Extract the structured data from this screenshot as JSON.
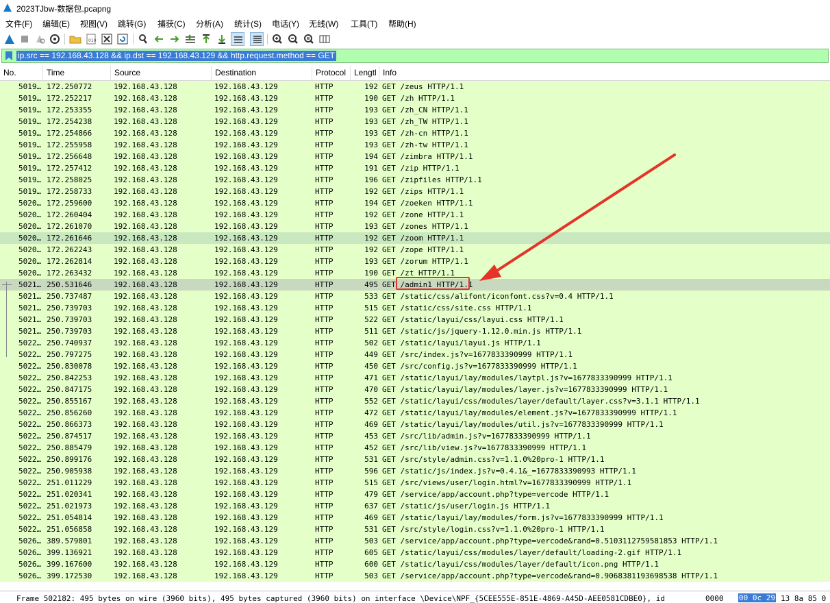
{
  "window": {
    "title": "2023TJbw-数据包.pcapng"
  },
  "menu": [
    "文件(F)",
    "编辑(E)",
    "视图(V)",
    "跳转(G)",
    "捕获(C)",
    "分析(A)",
    "统计(S)",
    "电话(Y)",
    "无线(W)",
    "工具(T)",
    "帮助(H)"
  ],
  "toolbar": {
    "icons": [
      "shark-fin-icon",
      "stop-icon",
      "restart-icon",
      "options-gear-icon",
      "open-folder-icon",
      "save-file-icon",
      "close-file-icon",
      "reload-icon",
      "find-icon",
      "back-arrow-icon",
      "forward-arrow-icon",
      "goto-packet-icon",
      "first-packet-icon",
      "last-packet-icon",
      "autoscroll-icon",
      "colorize-icon",
      "zoom-in-icon",
      "zoom-out-icon",
      "zoom-reset-icon",
      "resize-columns-icon"
    ]
  },
  "filter": {
    "value": "ip.src == 192.168.43.128 && ip.dst == 192.168.43.129 && http.request.method == GET"
  },
  "columns": [
    "No.",
    "Time",
    "Source",
    "Destination",
    "Protocol",
    "Lengtl",
    "Info"
  ],
  "packets": [
    {
      "no": "5019…",
      "time": "172.250772",
      "src": "192.168.43.128",
      "dst": "192.168.43.129",
      "proto": "HTTP",
      "len": "192",
      "info": "GET /zeus HTTP/1.1"
    },
    {
      "no": "5019…",
      "time": "172.252217",
      "src": "192.168.43.128",
      "dst": "192.168.43.129",
      "proto": "HTTP",
      "len": "190",
      "info": "GET /zh HTTP/1.1"
    },
    {
      "no": "5019…",
      "time": "172.253355",
      "src": "192.168.43.128",
      "dst": "192.168.43.129",
      "proto": "HTTP",
      "len": "193",
      "info": "GET /zh_CN HTTP/1.1"
    },
    {
      "no": "5019…",
      "time": "172.254238",
      "src": "192.168.43.128",
      "dst": "192.168.43.129",
      "proto": "HTTP",
      "len": "193",
      "info": "GET /zh_TW HTTP/1.1"
    },
    {
      "no": "5019…",
      "time": "172.254866",
      "src": "192.168.43.128",
      "dst": "192.168.43.129",
      "proto": "HTTP",
      "len": "193",
      "info": "GET /zh-cn HTTP/1.1"
    },
    {
      "no": "5019…",
      "time": "172.255958",
      "src": "192.168.43.128",
      "dst": "192.168.43.129",
      "proto": "HTTP",
      "len": "193",
      "info": "GET /zh-tw HTTP/1.1"
    },
    {
      "no": "5019…",
      "time": "172.256648",
      "src": "192.168.43.128",
      "dst": "192.168.43.129",
      "proto": "HTTP",
      "len": "194",
      "info": "GET /zimbra HTTP/1.1"
    },
    {
      "no": "5019…",
      "time": "172.257412",
      "src": "192.168.43.128",
      "dst": "192.168.43.129",
      "proto": "HTTP",
      "len": "191",
      "info": "GET /zip HTTP/1.1"
    },
    {
      "no": "5019…",
      "time": "172.258025",
      "src": "192.168.43.128",
      "dst": "192.168.43.129",
      "proto": "HTTP",
      "len": "196",
      "info": "GET /zipfiles HTTP/1.1"
    },
    {
      "no": "5019…",
      "time": "172.258733",
      "src": "192.168.43.128",
      "dst": "192.168.43.129",
      "proto": "HTTP",
      "len": "192",
      "info": "GET /zips HTTP/1.1"
    },
    {
      "no": "5020…",
      "time": "172.259600",
      "src": "192.168.43.128",
      "dst": "192.168.43.129",
      "proto": "HTTP",
      "len": "194",
      "info": "GET /zoeken HTTP/1.1"
    },
    {
      "no": "5020…",
      "time": "172.260404",
      "src": "192.168.43.128",
      "dst": "192.168.43.129",
      "proto": "HTTP",
      "len": "192",
      "info": "GET /zone HTTP/1.1"
    },
    {
      "no": "5020…",
      "time": "172.261070",
      "src": "192.168.43.128",
      "dst": "192.168.43.129",
      "proto": "HTTP",
      "len": "193",
      "info": "GET /zones HTTP/1.1"
    },
    {
      "no": "5020…",
      "time": "172.261646",
      "src": "192.168.43.128",
      "dst": "192.168.43.129",
      "proto": "HTTP",
      "len": "192",
      "info": "GET /zoom HTTP/1.1",
      "alt": true
    },
    {
      "no": "5020…",
      "time": "172.262243",
      "src": "192.168.43.128",
      "dst": "192.168.43.129",
      "proto": "HTTP",
      "len": "192",
      "info": "GET /zope HTTP/1.1"
    },
    {
      "no": "5020…",
      "time": "172.262814",
      "src": "192.168.43.128",
      "dst": "192.168.43.129",
      "proto": "HTTP",
      "len": "193",
      "info": "GET /zorum HTTP/1.1"
    },
    {
      "no": "5020…",
      "time": "172.263432",
      "src": "192.168.43.128",
      "dst": "192.168.43.129",
      "proto": "HTTP",
      "len": "190",
      "info": "GET /zt HTTP/1.1"
    },
    {
      "no": "5021…",
      "time": "250.531646",
      "src": "192.168.43.128",
      "dst": "192.168.43.129",
      "proto": "HTTP",
      "len": "495",
      "info": "GET /admin1 HTTP/1.1",
      "selected": true
    },
    {
      "no": "5021…",
      "time": "250.737487",
      "src": "192.168.43.128",
      "dst": "192.168.43.129",
      "proto": "HTTP",
      "len": "533",
      "info": "GET /static/css/alifont/iconfont.css?v=0.4 HTTP/1.1"
    },
    {
      "no": "5021…",
      "time": "250.739703",
      "src": "192.168.43.128",
      "dst": "192.168.43.129",
      "proto": "HTTP",
      "len": "515",
      "info": "GET /static/css/site.css HTTP/1.1"
    },
    {
      "no": "5021…",
      "time": "250.739703",
      "src": "192.168.43.128",
      "dst": "192.168.43.129",
      "proto": "HTTP",
      "len": "522",
      "info": "GET /static/layui/css/layui.css HTTP/1.1"
    },
    {
      "no": "5021…",
      "time": "250.739703",
      "src": "192.168.43.128",
      "dst": "192.168.43.129",
      "proto": "HTTP",
      "len": "511",
      "info": "GET /static/js/jquery-1.12.0.min.js HTTP/1.1"
    },
    {
      "no": "5022…",
      "time": "250.740937",
      "src": "192.168.43.128",
      "dst": "192.168.43.129",
      "proto": "HTTP",
      "len": "502",
      "info": "GET /static/layui/layui.js HTTP/1.1"
    },
    {
      "no": "5022…",
      "time": "250.797275",
      "src": "192.168.43.128",
      "dst": "192.168.43.129",
      "proto": "HTTP",
      "len": "449",
      "info": "GET /src/index.js?v=1677833390999 HTTP/1.1"
    },
    {
      "no": "5022…",
      "time": "250.830078",
      "src": "192.168.43.128",
      "dst": "192.168.43.129",
      "proto": "HTTP",
      "len": "450",
      "info": "GET /src/config.js?v=1677833390999 HTTP/1.1"
    },
    {
      "no": "5022…",
      "time": "250.842253",
      "src": "192.168.43.128",
      "dst": "192.168.43.129",
      "proto": "HTTP",
      "len": "471",
      "info": "GET /static/layui/lay/modules/laytpl.js?v=1677833390999 HTTP/1.1"
    },
    {
      "no": "5022…",
      "time": "250.847175",
      "src": "192.168.43.128",
      "dst": "192.168.43.129",
      "proto": "HTTP",
      "len": "470",
      "info": "GET /static/layui/lay/modules/layer.js?v=1677833390999 HTTP/1.1"
    },
    {
      "no": "5022…",
      "time": "250.855167",
      "src": "192.168.43.128",
      "dst": "192.168.43.129",
      "proto": "HTTP",
      "len": "552",
      "info": "GET /static/layui/css/modules/layer/default/layer.css?v=3.1.1 HTTP/1.1"
    },
    {
      "no": "5022…",
      "time": "250.856260",
      "src": "192.168.43.128",
      "dst": "192.168.43.129",
      "proto": "HTTP",
      "len": "472",
      "info": "GET /static/layui/lay/modules/element.js?v=1677833390999 HTTP/1.1"
    },
    {
      "no": "5022…",
      "time": "250.866373",
      "src": "192.168.43.128",
      "dst": "192.168.43.129",
      "proto": "HTTP",
      "len": "469",
      "info": "GET /static/layui/lay/modules/util.js?v=1677833390999 HTTP/1.1"
    },
    {
      "no": "5022…",
      "time": "250.874517",
      "src": "192.168.43.128",
      "dst": "192.168.43.129",
      "proto": "HTTP",
      "len": "453",
      "info": "GET /src/lib/admin.js?v=1677833390999 HTTP/1.1"
    },
    {
      "no": "5022…",
      "time": "250.885479",
      "src": "192.168.43.128",
      "dst": "192.168.43.129",
      "proto": "HTTP",
      "len": "452",
      "info": "GET /src/lib/view.js?v=1677833390999 HTTP/1.1"
    },
    {
      "no": "5022…",
      "time": "250.899176",
      "src": "192.168.43.128",
      "dst": "192.168.43.129",
      "proto": "HTTP",
      "len": "531",
      "info": "GET /src/style/admin.css?v=1.1.0%20pro-1 HTTP/1.1"
    },
    {
      "no": "5022…",
      "time": "250.905938",
      "src": "192.168.43.128",
      "dst": "192.168.43.129",
      "proto": "HTTP",
      "len": "596",
      "info": "GET /static/js/index.js?v=0.4.1&_=1677833390993 HTTP/1.1"
    },
    {
      "no": "5022…",
      "time": "251.011229",
      "src": "192.168.43.128",
      "dst": "192.168.43.129",
      "proto": "HTTP",
      "len": "515",
      "info": "GET /src/views/user/login.html?v=1677833390999 HTTP/1.1"
    },
    {
      "no": "5022…",
      "time": "251.020341",
      "src": "192.168.43.128",
      "dst": "192.168.43.129",
      "proto": "HTTP",
      "len": "479",
      "info": "GET /service/app/account.php?type=vercode HTTP/1.1"
    },
    {
      "no": "5022…",
      "time": "251.021973",
      "src": "192.168.43.128",
      "dst": "192.168.43.129",
      "proto": "HTTP",
      "len": "637",
      "info": "GET /static/js/user/login.js HTTP/1.1"
    },
    {
      "no": "5022…",
      "time": "251.054814",
      "src": "192.168.43.128",
      "dst": "192.168.43.129",
      "proto": "HTTP",
      "len": "469",
      "info": "GET /static/layui/lay/modules/form.js?v=1677833390999 HTTP/1.1"
    },
    {
      "no": "5022…",
      "time": "251.056858",
      "src": "192.168.43.128",
      "dst": "192.168.43.129",
      "proto": "HTTP",
      "len": "531",
      "info": "GET /src/style/login.css?v=1.1.0%20pro-1 HTTP/1.1"
    },
    {
      "no": "5026…",
      "time": "389.579801",
      "src": "192.168.43.128",
      "dst": "192.168.43.129",
      "proto": "HTTP",
      "len": "503",
      "info": "GET /service/app/account.php?type=vercode&rand=0.5103112759581853 HTTP/1.1"
    },
    {
      "no": "5026…",
      "time": "399.136921",
      "src": "192.168.43.128",
      "dst": "192.168.43.129",
      "proto": "HTTP",
      "len": "605",
      "info": "GET /static/layui/css/modules/layer/default/loading-2.gif HTTP/1.1"
    },
    {
      "no": "5026…",
      "time": "399.167600",
      "src": "192.168.43.128",
      "dst": "192.168.43.129",
      "proto": "HTTP",
      "len": "600",
      "info": "GET /static/layui/css/modules/layer/default/icon.png HTTP/1.1"
    },
    {
      "no": "5026…",
      "time": "399.172530",
      "src": "192.168.43.128",
      "dst": "192.168.43.129",
      "proto": "HTTP",
      "len": "503",
      "info": "GET /service/app/account.php?type=vercode&rand=0.9068381193698538 HTTP/1.1"
    }
  ],
  "status": {
    "text": "Frame 502182: 495 bytes on wire (3960 bits), 495 bytes captured (3960 bits) on interface \\Device\\NPF_{5CEE555E-851E-4869-A45D-AEE0581CDBE0}, id",
    "hex_offset": "0000",
    "hex_selected": "00 0c 29",
    "hex_rest": "13 8a 85 0"
  },
  "colors": {
    "row_bg": "#e4ffc7",
    "selected_row": "#c8d9c0",
    "filter_bg": "#afffaf",
    "annotation": "#e53329"
  }
}
